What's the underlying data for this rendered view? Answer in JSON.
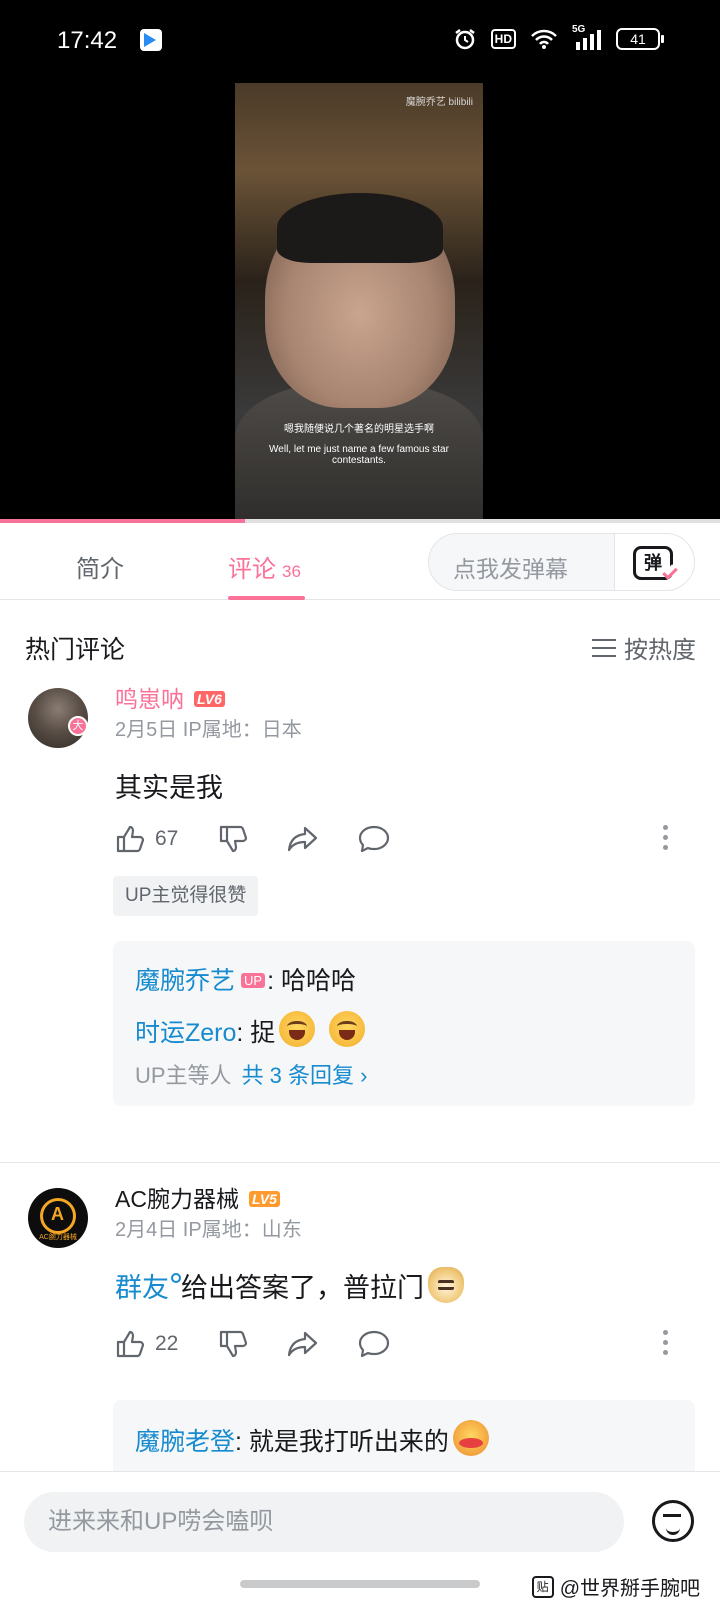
{
  "status_bar": {
    "time": "17:42",
    "network": "5G",
    "hd": "HD",
    "battery": "41"
  },
  "video": {
    "watermark": "魔腕乔艺 bilibili",
    "subtitle_cn": "嗯我随便说几个著名的明星选手啊",
    "subtitle_en": "Well, let me just name a few famous star contestants.",
    "progress": 0.34
  },
  "tabs": {
    "intro": "简介",
    "comments": "评论",
    "comment_count": "36"
  },
  "danmaku": {
    "placeholder": "点我发弹幕",
    "button": "弹"
  },
  "comments_header": {
    "title": "热门评论",
    "sort": "按热度"
  },
  "comments": [
    {
      "username": "鸣崽呐",
      "level": "LV6",
      "avatar_badge": "大",
      "meta": "2月5日  IP属地：日本",
      "text": "其实是我",
      "likes": "67",
      "up_badge": "UP主觉得很赞",
      "replies": [
        {
          "user": "魔腕乔艺",
          "is_up": true,
          "up_tag": "UP",
          "text": ": 哈哈哈"
        },
        {
          "user": "时运Zero",
          "text": ": 捉"
        }
      ],
      "reply_footer": {
        "by": "UP主等人",
        "more": "共 3 条回复 ›"
      }
    },
    {
      "username": "AC腕力器械",
      "level": "LV5",
      "avatar_text": "AC腕力器械",
      "meta": "2月4日  IP属地：山东",
      "text_link": "群友",
      "text": "给出答案了，普拉门",
      "likes": "22",
      "replies": [
        {
          "user": "魔腕老登",
          "text": ": 就是我打听出来的"
        }
      ]
    }
  ],
  "bottom_bar": {
    "placeholder": "进来来和UP唠会嗑呗"
  },
  "watermark": {
    "box": "贴",
    "text": "@世界掰手腕吧"
  },
  "colors": {
    "accent": "#fb7299",
    "link": "#178bcf",
    "text": "#18191c",
    "muted": "#9499a0"
  }
}
